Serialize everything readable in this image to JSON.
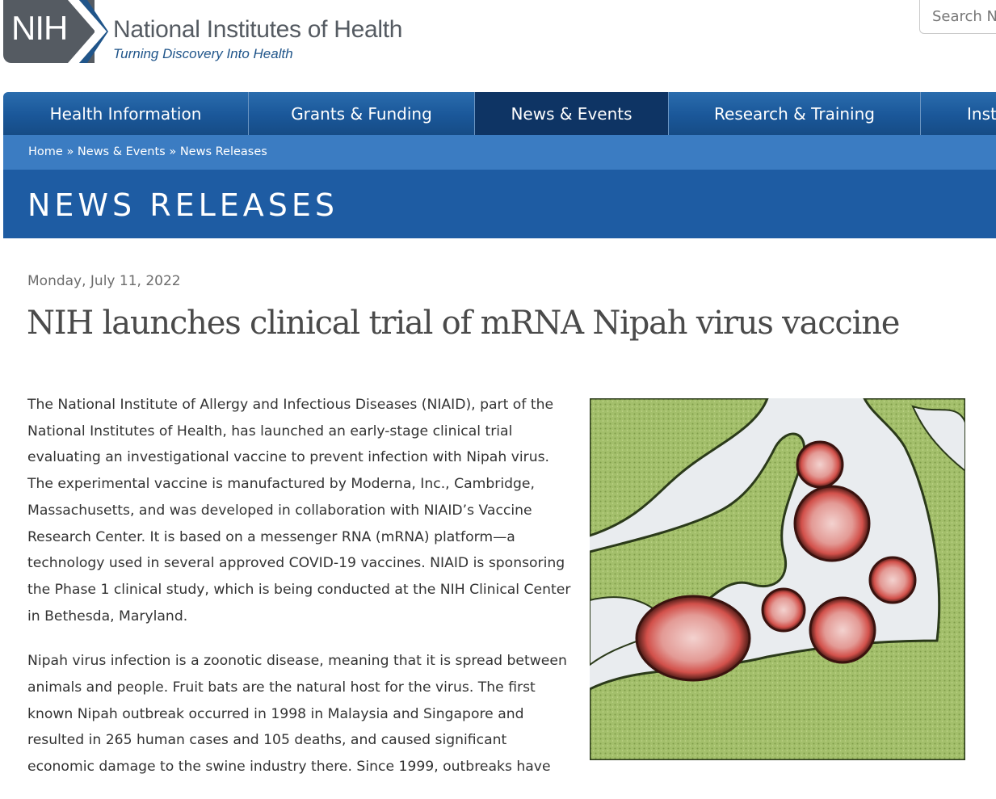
{
  "header": {
    "logo_text": "NIH",
    "site_name": "National Institutes of Health",
    "tagline": "Turning Discovery Into Health",
    "search_placeholder": "Search N"
  },
  "nav": {
    "items": [
      {
        "label": "Health Information"
      },
      {
        "label": "Grants & Funding"
      },
      {
        "label": "News & Events",
        "active": true
      },
      {
        "label": "Research & Training"
      },
      {
        "label": "Inst"
      }
    ]
  },
  "breadcrumb": {
    "home": "Home",
    "sep": "»",
    "news_events": "News & Events",
    "news_releases": "News Releases"
  },
  "page_title": "NEWS RELEASES",
  "article": {
    "date": "Monday, July 11, 2022",
    "headline": "NIH launches clinical trial of mRNA Nipah virus vaccine",
    "paragraphs": [
      "The National Institute of Allergy and Infectious Diseases (NIAID), part of the National Institutes of Health, has launched an early-stage clinical trial evaluating an investigational vaccine to prevent infection with Nipah virus. The experimental vaccine is manufactured by Moderna, Inc., Cambridge, Massachusetts, and was developed in collaboration with NIAID’s Vaccine Research Center. It is based on a messenger RNA (mRNA) platform—a technology used in several approved COVID-19 vaccines. NIAID is sponsoring the Phase 1 clinical study, which is being conducted at the NIH Clinical Center in Bethesda, Maryland.",
      "Nipah virus infection is a zoonotic disease, meaning that it is spread between animals and people. Fruit bats are the natural host for the virus. The first known Nipah outbreak occurred in 1998 in Malaysia and Singapore and resulted in 265 human cases and 105 deaths, and caused significant economic damage to the swine industry there. Since 1999, outbreaks have"
    ]
  },
  "colors": {
    "nav_blue": "#1a5799",
    "nav_active": "#0e3464",
    "breadcrumb_blue": "#3b7cc2",
    "title_band": "#1e5ca3",
    "logo_gray": "#555b62",
    "tagline_blue": "#20558a"
  }
}
